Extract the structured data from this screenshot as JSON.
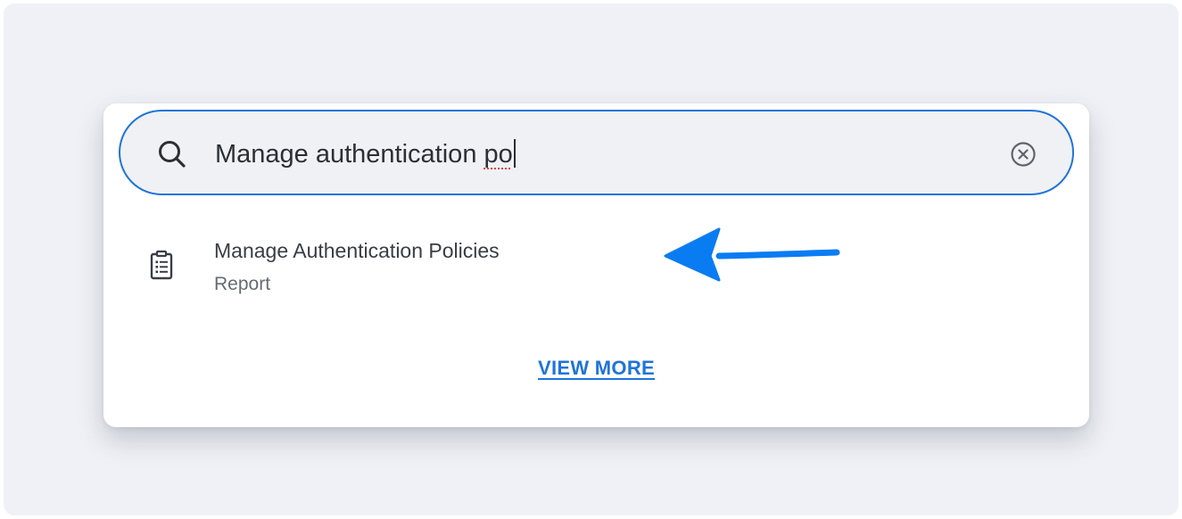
{
  "search": {
    "typed_main": "Manage authentication ",
    "typed_suffix": "po",
    "clear_icon": "clear-circle-x-icon",
    "search_icon": "magnifier-icon"
  },
  "results": [
    {
      "title": "Manage Authentication Policies",
      "type": "Report",
      "icon": "report-clipboard-icon"
    }
  ],
  "view_more_label": "VIEW MORE",
  "colors": {
    "accent": "#1f74d9",
    "annotation_arrow": "#0a7cf2",
    "background": "#eff1f6",
    "spellcheck": "#e0473b"
  }
}
